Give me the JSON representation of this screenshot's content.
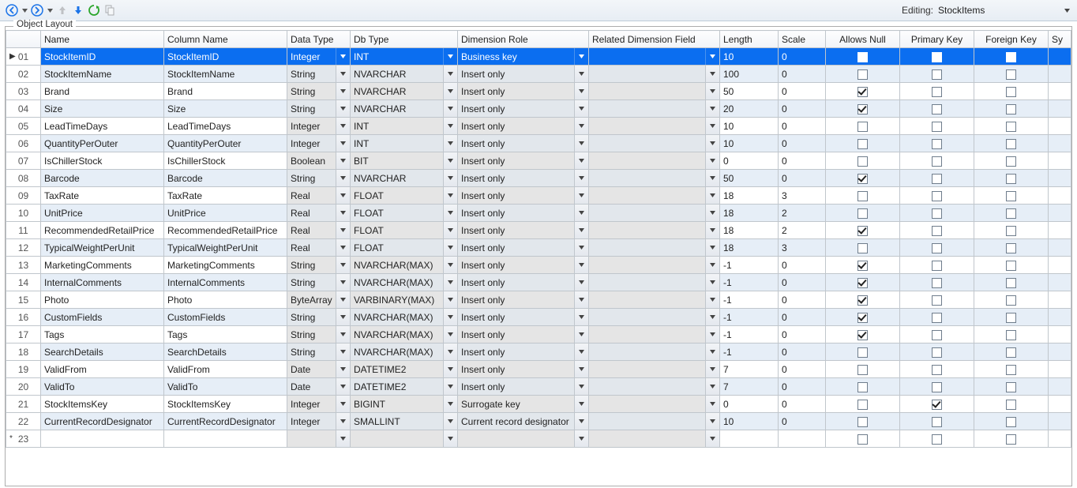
{
  "toolbar": {
    "editing_prefix": "Editing:",
    "editing_value": "StockItems"
  },
  "group": {
    "title": "Object Layout"
  },
  "headers": {
    "name": "Name",
    "column_name": "Column Name",
    "data_type": "Data Type",
    "db_type": "Db Type",
    "dimension_role": "Dimension Role",
    "related_dim": "Related Dimension Field",
    "length": "Length",
    "scale": "Scale",
    "allows_null": "Allows Null",
    "primary_key": "Primary Key",
    "foreign_key": "Foreign Key",
    "system_trunc": "Sy"
  },
  "rows": [
    {
      "ord": "01",
      "name": "StockItemID",
      "col": "StockItemID",
      "dtype": "Integer",
      "dbtype": "INT",
      "dimrole": "Business key",
      "rel": "",
      "len": "10",
      "scale": "0",
      "anull": false,
      "pkey": false,
      "fkey": false,
      "selected": true,
      "indicator": "▶"
    },
    {
      "ord": "02",
      "name": "StockItemName",
      "col": "StockItemName",
      "dtype": "String",
      "dbtype": "NVARCHAR",
      "dimrole": "Insert only",
      "rel": "",
      "len": "100",
      "scale": "0",
      "anull": false,
      "pkey": false,
      "fkey": false
    },
    {
      "ord": "03",
      "name": "Brand",
      "col": "Brand",
      "dtype": "String",
      "dbtype": "NVARCHAR",
      "dimrole": "Insert only",
      "rel": "",
      "len": "50",
      "scale": "0",
      "anull": true,
      "pkey": false,
      "fkey": false
    },
    {
      "ord": "04",
      "name": "Size",
      "col": "Size",
      "dtype": "String",
      "dbtype": "NVARCHAR",
      "dimrole": "Insert only",
      "rel": "",
      "len": "20",
      "scale": "0",
      "anull": true,
      "pkey": false,
      "fkey": false
    },
    {
      "ord": "05",
      "name": "LeadTimeDays",
      "col": "LeadTimeDays",
      "dtype": "Integer",
      "dbtype": "INT",
      "dimrole": "Insert only",
      "rel": "",
      "len": "10",
      "scale": "0",
      "anull": false,
      "pkey": false,
      "fkey": false
    },
    {
      "ord": "06",
      "name": "QuantityPerOuter",
      "col": "QuantityPerOuter",
      "dtype": "Integer",
      "dbtype": "INT",
      "dimrole": "Insert only",
      "rel": "",
      "len": "10",
      "scale": "0",
      "anull": false,
      "pkey": false,
      "fkey": false
    },
    {
      "ord": "07",
      "name": "IsChillerStock",
      "col": "IsChillerStock",
      "dtype": "Boolean",
      "dbtype": "BIT",
      "dimrole": "Insert only",
      "rel": "",
      "len": "0",
      "scale": "0",
      "anull": false,
      "pkey": false,
      "fkey": false
    },
    {
      "ord": "08",
      "name": "Barcode",
      "col": "Barcode",
      "dtype": "String",
      "dbtype": "NVARCHAR",
      "dimrole": "Insert only",
      "rel": "",
      "len": "50",
      "scale": "0",
      "anull": true,
      "pkey": false,
      "fkey": false
    },
    {
      "ord": "09",
      "name": "TaxRate",
      "col": "TaxRate",
      "dtype": "Real",
      "dbtype": "FLOAT",
      "dimrole": "Insert only",
      "rel": "",
      "len": "18",
      "scale": "3",
      "anull": false,
      "pkey": false,
      "fkey": false
    },
    {
      "ord": "10",
      "name": "UnitPrice",
      "col": "UnitPrice",
      "dtype": "Real",
      "dbtype": "FLOAT",
      "dimrole": "Insert only",
      "rel": "",
      "len": "18",
      "scale": "2",
      "anull": false,
      "pkey": false,
      "fkey": false
    },
    {
      "ord": "11",
      "name": "RecommendedRetailPrice",
      "col": "RecommendedRetailPrice",
      "dtype": "Real",
      "dbtype": "FLOAT",
      "dimrole": "Insert only",
      "rel": "",
      "len": "18",
      "scale": "2",
      "anull": true,
      "pkey": false,
      "fkey": false
    },
    {
      "ord": "12",
      "name": "TypicalWeightPerUnit",
      "col": "TypicalWeightPerUnit",
      "dtype": "Real",
      "dbtype": "FLOAT",
      "dimrole": "Insert only",
      "rel": "",
      "len": "18",
      "scale": "3",
      "anull": false,
      "pkey": false,
      "fkey": false
    },
    {
      "ord": "13",
      "name": "MarketingComments",
      "col": "MarketingComments",
      "dtype": "String",
      "dbtype": "NVARCHAR(MAX)",
      "dimrole": "Insert only",
      "rel": "",
      "len": "-1",
      "scale": "0",
      "anull": true,
      "pkey": false,
      "fkey": false
    },
    {
      "ord": "14",
      "name": "InternalComments",
      "col": "InternalComments",
      "dtype": "String",
      "dbtype": "NVARCHAR(MAX)",
      "dimrole": "Insert only",
      "rel": "",
      "len": "-1",
      "scale": "0",
      "anull": true,
      "pkey": false,
      "fkey": false
    },
    {
      "ord": "15",
      "name": "Photo",
      "col": "Photo",
      "dtype": "ByteArray",
      "dbtype": "VARBINARY(MAX)",
      "dimrole": "Insert only",
      "rel": "",
      "len": "-1",
      "scale": "0",
      "anull": true,
      "pkey": false,
      "fkey": false
    },
    {
      "ord": "16",
      "name": "CustomFields",
      "col": "CustomFields",
      "dtype": "String",
      "dbtype": "NVARCHAR(MAX)",
      "dimrole": "Insert only",
      "rel": "",
      "len": "-1",
      "scale": "0",
      "anull": true,
      "pkey": false,
      "fkey": false
    },
    {
      "ord": "17",
      "name": "Tags",
      "col": "Tags",
      "dtype": "String",
      "dbtype": "NVARCHAR(MAX)",
      "dimrole": "Insert only",
      "rel": "",
      "len": "-1",
      "scale": "0",
      "anull": true,
      "pkey": false,
      "fkey": false
    },
    {
      "ord": "18",
      "name": "SearchDetails",
      "col": "SearchDetails",
      "dtype": "String",
      "dbtype": "NVARCHAR(MAX)",
      "dimrole": "Insert only",
      "rel": "",
      "len": "-1",
      "scale": "0",
      "anull": false,
      "pkey": false,
      "fkey": false
    },
    {
      "ord": "19",
      "name": "ValidFrom",
      "col": "ValidFrom",
      "dtype": "Date",
      "dbtype": "DATETIME2",
      "dimrole": "Insert only",
      "rel": "",
      "len": "7",
      "scale": "0",
      "anull": false,
      "pkey": false,
      "fkey": false
    },
    {
      "ord": "20",
      "name": "ValidTo",
      "col": "ValidTo",
      "dtype": "Date",
      "dbtype": "DATETIME2",
      "dimrole": "Insert only",
      "rel": "",
      "len": "7",
      "scale": "0",
      "anull": false,
      "pkey": false,
      "fkey": false
    },
    {
      "ord": "21",
      "name": "StockItemsKey",
      "col": "StockItemsKey",
      "dtype": "Integer",
      "dbtype": "BIGINT",
      "dimrole": "Surrogate key",
      "rel": "",
      "len": "0",
      "scale": "0",
      "anull": false,
      "pkey": true,
      "fkey": false
    },
    {
      "ord": "22",
      "name": "CurrentRecordDesignator",
      "col": "CurrentRecordDesignator",
      "dtype": "Integer",
      "dbtype": "SMALLINT",
      "dimrole": "Current record designator",
      "rel": "",
      "len": "10",
      "scale": "0",
      "anull": false,
      "pkey": false,
      "fkey": false
    },
    {
      "ord": "23",
      "name": "",
      "col": "",
      "dtype": "",
      "dbtype": "",
      "dimrole": "",
      "rel": "",
      "len": "",
      "scale": "",
      "anull": false,
      "pkey": false,
      "fkey": false,
      "new_row": true,
      "indicator": "*"
    }
  ]
}
